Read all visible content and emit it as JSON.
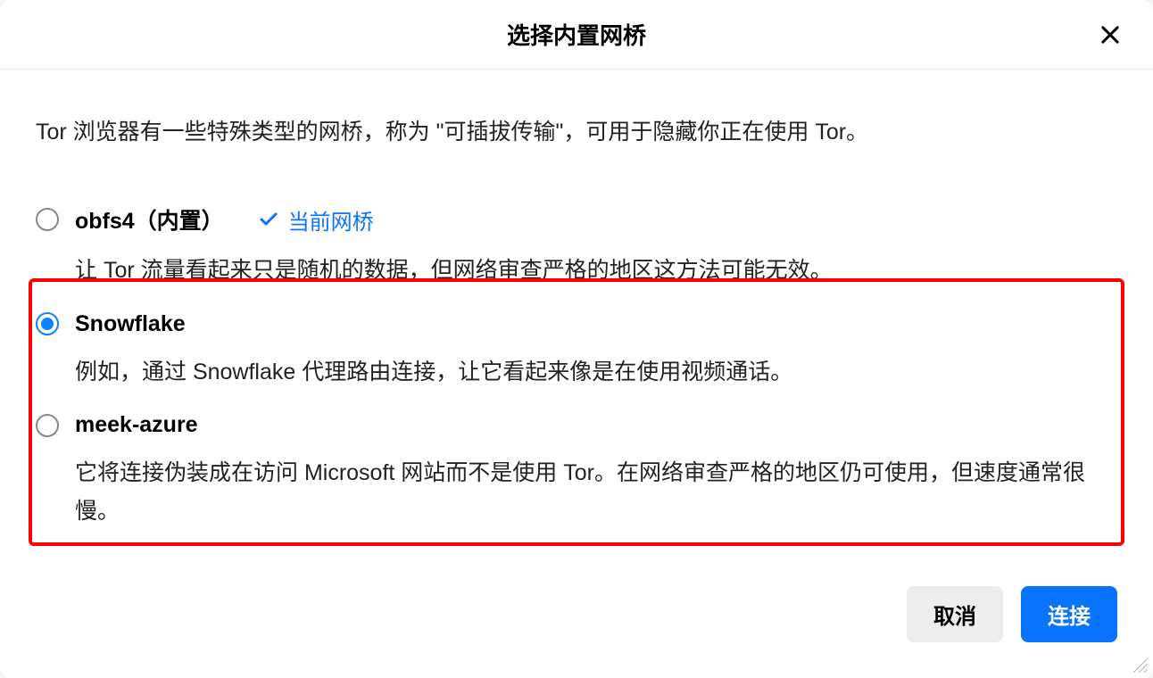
{
  "dialog": {
    "title": "选择内置网桥",
    "intro": "Tor 浏览器有一些特殊类型的网桥，称为 \"可插拔传输\"，可用于隐藏你正在使用 Tor。",
    "current_badge": "当前网桥",
    "options": [
      {
        "name": "obfs4（内置）",
        "desc": "让 Tor 流量看起来只是随机的数据，但网络审查严格的地区这方法可能无效。",
        "selected": false,
        "current": true
      },
      {
        "name": "Snowflake",
        "desc": "例如，通过 Snowflake 代理路由连接，让它看起来像是在使用视频通话。",
        "selected": true,
        "current": false
      },
      {
        "name": "meek-azure",
        "desc": "它将连接伪装成在访问 Microsoft 网站而不是使用 Tor。在网络审查严格的地区仍可使用，但速度通常很慢。",
        "selected": false,
        "current": false
      }
    ],
    "buttons": {
      "cancel": "取消",
      "connect": "连接"
    }
  }
}
